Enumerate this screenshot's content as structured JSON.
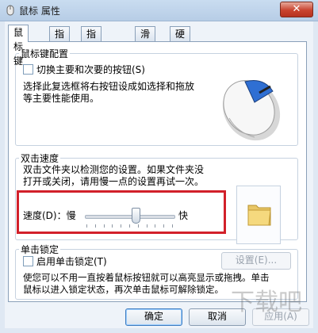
{
  "window": {
    "title": "鼠标 属性",
    "close_label": "✕"
  },
  "tabs": [
    {
      "label": "鼠标键"
    },
    {
      "label": "指针"
    },
    {
      "label": "指针选项"
    },
    {
      "label": "滑轮"
    },
    {
      "label": "硬件"
    }
  ],
  "active_tab": "鼠标键",
  "button_config": {
    "legend": "鼠标键配置",
    "checkbox_label": "切换主要和次要的按钮(S)",
    "checked": false,
    "desc_line1": "选择此复选框将右按钮设成如选择和拖放",
    "desc_line2": "等主要性能使用。"
  },
  "double_click": {
    "legend": "双击速度",
    "desc_line1": "双击文件夹以检测您的设置。如果文件夹没",
    "desc_line2": "打开或关闭，请用慢一点的设置再试一次。",
    "speed_label": "速度(D)：慢",
    "fast_label": "快",
    "speed_value_fraction": 0.57,
    "tick_count": 11
  },
  "click_lock": {
    "legend": "单击锁定",
    "checkbox_label": "启用单击锁定(T)",
    "checked": false,
    "settings_label": "设置(E)...",
    "desc_line1": "使您可以不用一直按着鼠标按钮就可以高亮显示或拖拽。单击",
    "desc_line2": "鼠标以进入锁定状态，再次单击鼠标可解除锁定。"
  },
  "footer": {
    "ok_label": "确定",
    "cancel_label": "取消",
    "apply_label": "应用(A)"
  },
  "watermark": {
    "text": "下载吧"
  },
  "colors": {
    "highlight": "#d2202a"
  }
}
